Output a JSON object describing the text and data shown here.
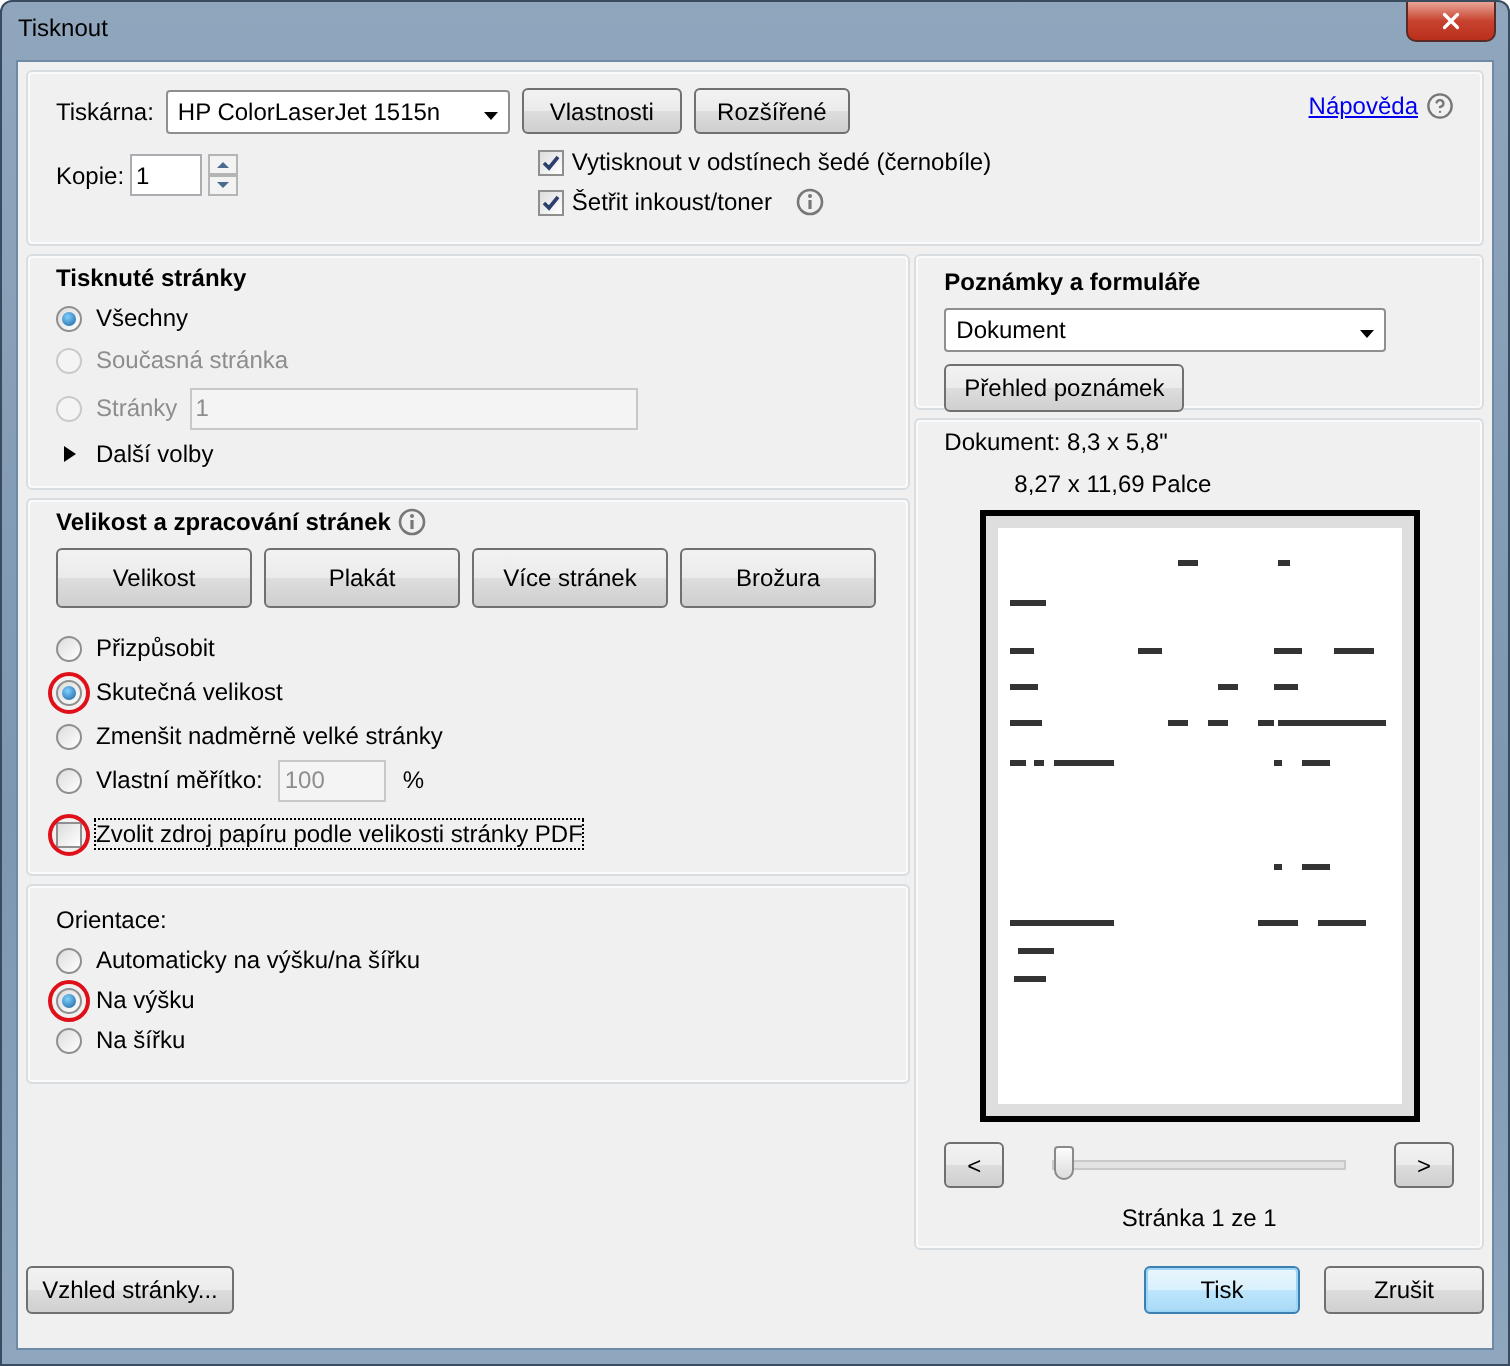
{
  "window": {
    "title": "Tisknout"
  },
  "printer": {
    "label": "Tiskárna:",
    "value": "HP ColorLaserJet 1515n",
    "buttons": [
      "Vlastnosti",
      "Rozšířené"
    ],
    "help_link": "Nápověda"
  },
  "copies": {
    "label": "Kopie:",
    "value": "1"
  },
  "print_options": [
    {
      "label": "Vytisknout v odstínech šedé (černobíle)",
      "checked": true,
      "info": false
    },
    {
      "label": "Šetřit inkoust/toner",
      "checked": true,
      "info": true
    }
  ],
  "pages_panel": {
    "title": "Tisknuté stránky",
    "options": [
      {
        "label": "Všechny",
        "selected": true,
        "disabled": false
      },
      {
        "label": "Současná stránka",
        "selected": false,
        "disabled": true
      },
      {
        "label": "Stránky",
        "selected": false,
        "disabled": true,
        "field_value": "1"
      }
    ],
    "more": "Další volby"
  },
  "sizing_panel": {
    "title": "Velikost a zpracování stránek",
    "modes": [
      "Velikost",
      "Plakát",
      "Více stránek",
      "Brožura"
    ],
    "options": [
      {
        "label": "Přizpůsobit",
        "selected": false,
        "highlighted": false
      },
      {
        "label": "Skutečná velikost",
        "selected": true,
        "highlighted": true
      },
      {
        "label": "Zmenšit nadměrně velké stránky",
        "selected": false,
        "highlighted": false
      },
      {
        "label": "Vlastní měřítko:",
        "selected": false,
        "highlighted": false,
        "field_value": "100",
        "unit": "%"
      }
    ],
    "paper_source": {
      "label": "Zvolit zdroj papíru podle velikosti stránky PDF",
      "checked": false,
      "highlighted": true
    }
  },
  "orientation_panel": {
    "title": "Orientace:",
    "options": [
      {
        "label": "Automaticky na výšku/na šířku",
        "selected": false,
        "highlighted": false
      },
      {
        "label": "Na výšku",
        "selected": true,
        "highlighted": true
      },
      {
        "label": "Na šířku",
        "selected": false,
        "highlighted": false
      }
    ]
  },
  "page_setup_button": "Vzhled stránky...",
  "notes_panel": {
    "title": "Poznámky a formuláře",
    "value": "Dokument",
    "button": "Přehled poznámek"
  },
  "preview": {
    "document_size": "Dokument: 8,3 x 5,8\"",
    "paper_size": "8,27 x 11,69 Palce",
    "prev": "<",
    "next": ">",
    "slider": {
      "level": 0
    },
    "page_label": "Stránka 1 ze 1"
  },
  "actions": [
    {
      "label": "Tisk",
      "kind": "default"
    },
    {
      "label": "Zrušit",
      "kind": "normal"
    }
  ]
}
